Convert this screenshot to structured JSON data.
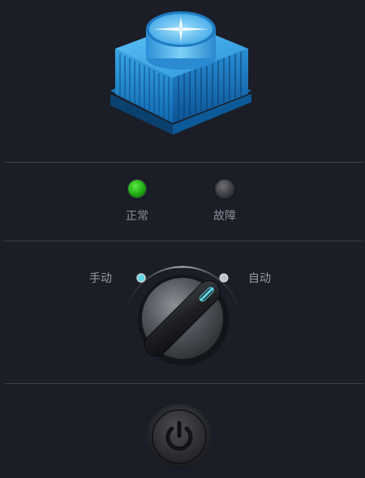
{
  "status": {
    "normal_label": "正常",
    "fault_label": "故障",
    "normal_color": "#1ea814",
    "fault_color": "#3c3d41"
  },
  "mode": {
    "manual_label": "手动",
    "auto_label": "自动",
    "selected": "手动",
    "indicator_active_color": "#5fd7e6"
  },
  "icons": {
    "tower": "cooling-tower-icon",
    "power": "power-icon"
  }
}
